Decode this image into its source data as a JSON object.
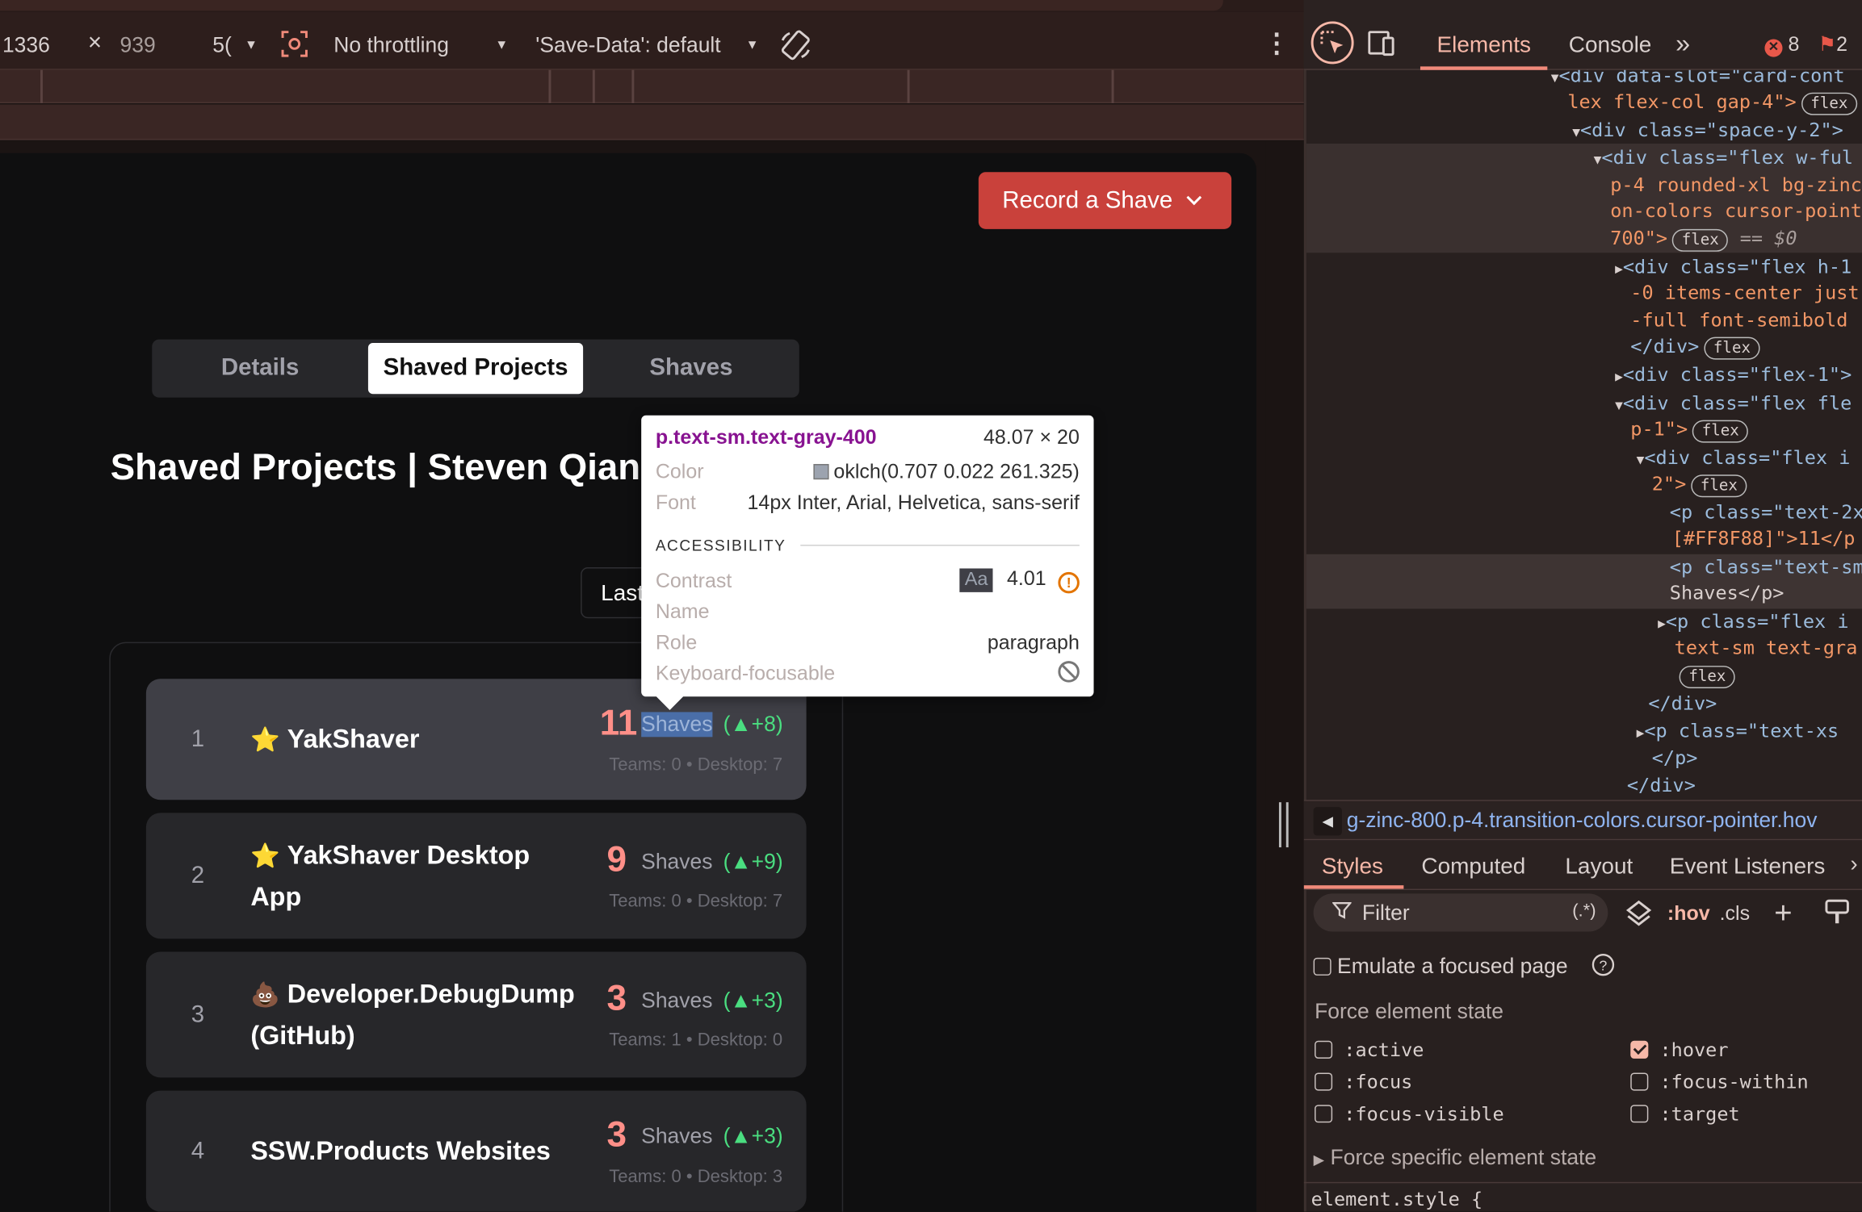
{
  "device_toolbar": {
    "width": "1336",
    "times": "×",
    "height": "939",
    "zoom": "5(",
    "throttle": "No throttling",
    "save_data": "'Save-Data': default"
  },
  "page": {
    "record_button": "Record a Shave",
    "tabs": [
      "Details",
      "Shaved Projects",
      "Shaves"
    ],
    "title": "Shaved Projects | Steven Qiang",
    "filter_button": "Last",
    "projects": [
      {
        "rank": "1",
        "emoji": "⭐",
        "name": "YakShaver",
        "count": "11",
        "label": "Shaves",
        "delta": "(▲+8)",
        "meta": "Teams: 0 • Desktop: 7"
      },
      {
        "rank": "2",
        "emoji": "⭐",
        "name_line1": "YakShaver Desktop",
        "name_line2": "App",
        "count": "9",
        "label": "Shaves",
        "delta": "(▲+9)",
        "meta": "Teams: 0 • Desktop: 7"
      },
      {
        "rank": "3",
        "emoji": "💩",
        "name_line1": "Developer.DebugDump",
        "name_line2": "(GitHub)",
        "count": "3",
        "label": "Shaves",
        "delta": "(▲+3)",
        "meta": "Teams: 1 • Desktop: 0"
      },
      {
        "rank": "4",
        "name": "SSW.Products Websites",
        "count": "3",
        "label": "Shaves",
        "delta": "(▲+3)",
        "meta": "Teams: 0 • Desktop: 3"
      }
    ]
  },
  "tooltip": {
    "selector": "p.text-sm.text-gray-400",
    "size": "48.07 × 20",
    "color_label": "Color",
    "color_value": "oklch(0.707 0.022 261.325)",
    "font_label": "Font",
    "font_value": "14px Inter, Arial, Helvetica, sans-serif",
    "section": "ACCESSIBILITY",
    "contrast_label": "Contrast",
    "contrast_aa": "Aa",
    "contrast_value": "4.01",
    "name_label": "Name",
    "role_label": "Role",
    "role_value": "paragraph",
    "focusable_label": "Keyboard-focusable"
  },
  "devtools": {
    "tabs": [
      "Elements",
      "Console"
    ],
    "more": "»",
    "errors": "8",
    "issues": "2",
    "dom_lines": [
      "<div data-slot=\"card-cont",
      "lex flex-col gap-4\">",
      "<div class=\"space-y-2\">",
      "<div class=\"flex w-ful",
      "p-4 rounded-xl bg-zinc",
      "on-colors cursor-point",
      "700\">",
      "== $0",
      "<div class=\"flex h-1",
      "-0 items-center just",
      "-full font-semibold",
      "</div>",
      "<div class=\"flex-1\">",
      "<div class=\"flex fle",
      "p-1\">",
      "<div class=\"flex i",
      "2\">",
      "<p class=\"text-2x",
      "[#FF8F88]\">11</p",
      "<p class=\"text-sm",
      "Shaves</p>",
      "<p class=\"flex i",
      "text-sm text-gra",
      "</div>",
      "<p class=\"text-xs",
      "</p>",
      "</div>"
    ],
    "badge": "flex",
    "breadcrumb": "g-zinc-800.p-4.transition-colors.cursor-pointer.hov",
    "style_tabs": [
      "Styles",
      "Computed",
      "Layout",
      "Event Listeners"
    ],
    "filter_placeholder": "Filter",
    "filter_regex": "(.*)",
    "hov": ":hov",
    "cls": ".cls",
    "emulate_focus": "Emulate a focused page",
    "force_state_title": "Force element state",
    "states_left": [
      ":active",
      ":focus",
      ":focus-visible"
    ],
    "states_right": [
      ":hover",
      ":focus-within",
      ":target"
    ],
    "force_specific": "Force specific element state",
    "element_style": "element.style {"
  },
  "colors": {
    "accent": "#c9413b",
    "count": "#ff8f88",
    "delta": "#4ade80"
  }
}
